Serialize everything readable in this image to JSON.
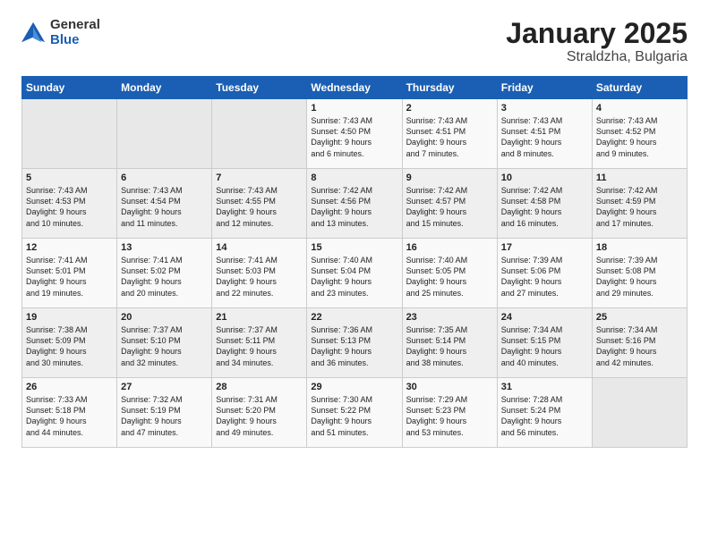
{
  "header": {
    "logo_general": "General",
    "logo_blue": "Blue",
    "title": "January 2025",
    "location": "Straldzha, Bulgaria"
  },
  "days_of_week": [
    "Sunday",
    "Monday",
    "Tuesday",
    "Wednesday",
    "Thursday",
    "Friday",
    "Saturday"
  ],
  "weeks": [
    [
      {
        "day": "",
        "empty": true,
        "lines": []
      },
      {
        "day": "",
        "empty": true,
        "lines": []
      },
      {
        "day": "",
        "empty": true,
        "lines": []
      },
      {
        "day": "1",
        "empty": false,
        "lines": [
          "Sunrise: 7:43 AM",
          "Sunset: 4:50 PM",
          "Daylight: 9 hours",
          "and 6 minutes."
        ]
      },
      {
        "day": "2",
        "empty": false,
        "lines": [
          "Sunrise: 7:43 AM",
          "Sunset: 4:51 PM",
          "Daylight: 9 hours",
          "and 7 minutes."
        ]
      },
      {
        "day": "3",
        "empty": false,
        "lines": [
          "Sunrise: 7:43 AM",
          "Sunset: 4:51 PM",
          "Daylight: 9 hours",
          "and 8 minutes."
        ]
      },
      {
        "day": "4",
        "empty": false,
        "lines": [
          "Sunrise: 7:43 AM",
          "Sunset: 4:52 PM",
          "Daylight: 9 hours",
          "and 9 minutes."
        ]
      }
    ],
    [
      {
        "day": "5",
        "empty": false,
        "lines": [
          "Sunrise: 7:43 AM",
          "Sunset: 4:53 PM",
          "Daylight: 9 hours",
          "and 10 minutes."
        ]
      },
      {
        "day": "6",
        "empty": false,
        "lines": [
          "Sunrise: 7:43 AM",
          "Sunset: 4:54 PM",
          "Daylight: 9 hours",
          "and 11 minutes."
        ]
      },
      {
        "day": "7",
        "empty": false,
        "lines": [
          "Sunrise: 7:43 AM",
          "Sunset: 4:55 PM",
          "Daylight: 9 hours",
          "and 12 minutes."
        ]
      },
      {
        "day": "8",
        "empty": false,
        "lines": [
          "Sunrise: 7:42 AM",
          "Sunset: 4:56 PM",
          "Daylight: 9 hours",
          "and 13 minutes."
        ]
      },
      {
        "day": "9",
        "empty": false,
        "lines": [
          "Sunrise: 7:42 AM",
          "Sunset: 4:57 PM",
          "Daylight: 9 hours",
          "and 15 minutes."
        ]
      },
      {
        "day": "10",
        "empty": false,
        "lines": [
          "Sunrise: 7:42 AM",
          "Sunset: 4:58 PM",
          "Daylight: 9 hours",
          "and 16 minutes."
        ]
      },
      {
        "day": "11",
        "empty": false,
        "lines": [
          "Sunrise: 7:42 AM",
          "Sunset: 4:59 PM",
          "Daylight: 9 hours",
          "and 17 minutes."
        ]
      }
    ],
    [
      {
        "day": "12",
        "empty": false,
        "lines": [
          "Sunrise: 7:41 AM",
          "Sunset: 5:01 PM",
          "Daylight: 9 hours",
          "and 19 minutes."
        ]
      },
      {
        "day": "13",
        "empty": false,
        "lines": [
          "Sunrise: 7:41 AM",
          "Sunset: 5:02 PM",
          "Daylight: 9 hours",
          "and 20 minutes."
        ]
      },
      {
        "day": "14",
        "empty": false,
        "lines": [
          "Sunrise: 7:41 AM",
          "Sunset: 5:03 PM",
          "Daylight: 9 hours",
          "and 22 minutes."
        ]
      },
      {
        "day": "15",
        "empty": false,
        "lines": [
          "Sunrise: 7:40 AM",
          "Sunset: 5:04 PM",
          "Daylight: 9 hours",
          "and 23 minutes."
        ]
      },
      {
        "day": "16",
        "empty": false,
        "lines": [
          "Sunrise: 7:40 AM",
          "Sunset: 5:05 PM",
          "Daylight: 9 hours",
          "and 25 minutes."
        ]
      },
      {
        "day": "17",
        "empty": false,
        "lines": [
          "Sunrise: 7:39 AM",
          "Sunset: 5:06 PM",
          "Daylight: 9 hours",
          "and 27 minutes."
        ]
      },
      {
        "day": "18",
        "empty": false,
        "lines": [
          "Sunrise: 7:39 AM",
          "Sunset: 5:08 PM",
          "Daylight: 9 hours",
          "and 29 minutes."
        ]
      }
    ],
    [
      {
        "day": "19",
        "empty": false,
        "lines": [
          "Sunrise: 7:38 AM",
          "Sunset: 5:09 PM",
          "Daylight: 9 hours",
          "and 30 minutes."
        ]
      },
      {
        "day": "20",
        "empty": false,
        "lines": [
          "Sunrise: 7:37 AM",
          "Sunset: 5:10 PM",
          "Daylight: 9 hours",
          "and 32 minutes."
        ]
      },
      {
        "day": "21",
        "empty": false,
        "lines": [
          "Sunrise: 7:37 AM",
          "Sunset: 5:11 PM",
          "Daylight: 9 hours",
          "and 34 minutes."
        ]
      },
      {
        "day": "22",
        "empty": false,
        "lines": [
          "Sunrise: 7:36 AM",
          "Sunset: 5:13 PM",
          "Daylight: 9 hours",
          "and 36 minutes."
        ]
      },
      {
        "day": "23",
        "empty": false,
        "lines": [
          "Sunrise: 7:35 AM",
          "Sunset: 5:14 PM",
          "Daylight: 9 hours",
          "and 38 minutes."
        ]
      },
      {
        "day": "24",
        "empty": false,
        "lines": [
          "Sunrise: 7:34 AM",
          "Sunset: 5:15 PM",
          "Daylight: 9 hours",
          "and 40 minutes."
        ]
      },
      {
        "day": "25",
        "empty": false,
        "lines": [
          "Sunrise: 7:34 AM",
          "Sunset: 5:16 PM",
          "Daylight: 9 hours",
          "and 42 minutes."
        ]
      }
    ],
    [
      {
        "day": "26",
        "empty": false,
        "lines": [
          "Sunrise: 7:33 AM",
          "Sunset: 5:18 PM",
          "Daylight: 9 hours",
          "and 44 minutes."
        ]
      },
      {
        "day": "27",
        "empty": false,
        "lines": [
          "Sunrise: 7:32 AM",
          "Sunset: 5:19 PM",
          "Daylight: 9 hours",
          "and 47 minutes."
        ]
      },
      {
        "day": "28",
        "empty": false,
        "lines": [
          "Sunrise: 7:31 AM",
          "Sunset: 5:20 PM",
          "Daylight: 9 hours",
          "and 49 minutes."
        ]
      },
      {
        "day": "29",
        "empty": false,
        "lines": [
          "Sunrise: 7:30 AM",
          "Sunset: 5:22 PM",
          "Daylight: 9 hours",
          "and 51 minutes."
        ]
      },
      {
        "day": "30",
        "empty": false,
        "lines": [
          "Sunrise: 7:29 AM",
          "Sunset: 5:23 PM",
          "Daylight: 9 hours",
          "and 53 minutes."
        ]
      },
      {
        "day": "31",
        "empty": false,
        "lines": [
          "Sunrise: 7:28 AM",
          "Sunset: 5:24 PM",
          "Daylight: 9 hours",
          "and 56 minutes."
        ]
      },
      {
        "day": "",
        "empty": true,
        "lines": []
      }
    ]
  ]
}
